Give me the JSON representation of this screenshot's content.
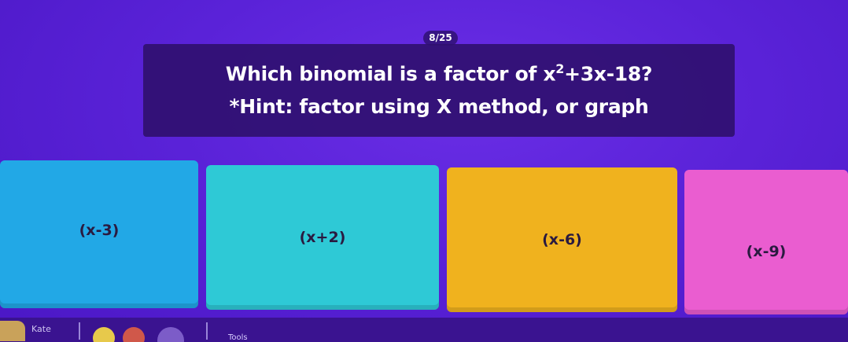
{
  "progress": {
    "label": "8/25"
  },
  "question": {
    "line1_prefix": "Which binomial is a factor of ",
    "expr_base": "x",
    "expr_exponent": "2",
    "expr_rest": "+3x-18?",
    "line2": "*Hint: factor using X method, or graph"
  },
  "answers": [
    {
      "label": "(x-3)",
      "color": "#22a8e6"
    },
    {
      "label": "(x+2)",
      "color": "#2ec9d6"
    },
    {
      "label": "(x-6)",
      "color": "#f0b21e"
    },
    {
      "label": "(x-9)",
      "color": "#ea5dd0"
    }
  ],
  "footer": {
    "player_name": "Kate",
    "tools_label": "Tools"
  }
}
